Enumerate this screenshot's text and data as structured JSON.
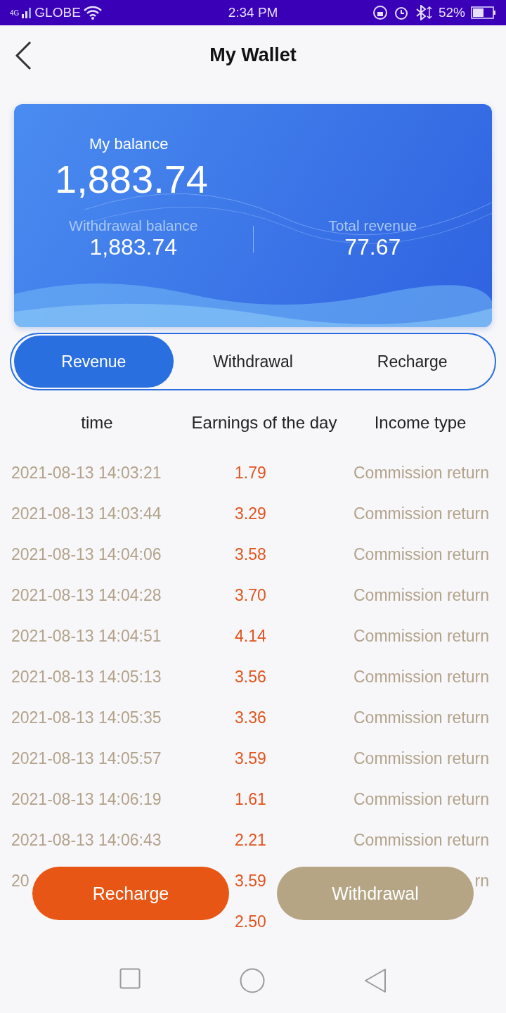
{
  "status_bar": {
    "network": "4G",
    "carrier": "GLOBE",
    "time": "2:34 PM",
    "battery": "52%"
  },
  "header": {
    "title": "My Wallet"
  },
  "balance_card": {
    "label": "My balance",
    "amount": "1,883.74",
    "stats": [
      {
        "label": "Withdrawal balance",
        "value": "1,883.74"
      },
      {
        "label": "Total revenue",
        "value": "77.67"
      }
    ]
  },
  "tabs": [
    {
      "label": "Revenue",
      "selected": true
    },
    {
      "label": "Withdrawal",
      "selected": false
    },
    {
      "label": "Recharge",
      "selected": false
    }
  ],
  "table": {
    "columns": [
      "time",
      "Earnings of the day",
      "Income type"
    ],
    "rows": [
      {
        "time": "2021-08-13 14:03:21",
        "amount": "1.79",
        "type": "Commission return"
      },
      {
        "time": "2021-08-13 14:03:44",
        "amount": "3.29",
        "type": "Commission return"
      },
      {
        "time": "2021-08-13 14:04:06",
        "amount": "3.58",
        "type": "Commission return"
      },
      {
        "time": "2021-08-13 14:04:28",
        "amount": "3.70",
        "type": "Commission return"
      },
      {
        "time": "2021-08-13 14:04:51",
        "amount": "4.14",
        "type": "Commission return"
      },
      {
        "time": "2021-08-13 14:05:13",
        "amount": "3.56",
        "type": "Commission return"
      },
      {
        "time": "2021-08-13 14:05:35",
        "amount": "3.36",
        "type": "Commission return"
      },
      {
        "time": "2021-08-13 14:05:57",
        "amount": "3.59",
        "type": "Commission return"
      },
      {
        "time": "2021-08-13 14:06:19",
        "amount": "1.61",
        "type": "Commission return"
      },
      {
        "time": "2021-08-13 14:06:43",
        "amount": "2.21",
        "type": "Commission return"
      },
      {
        "time": "20",
        "amount": "3.59",
        "type": "rn"
      },
      {
        "amount": "2.50"
      }
    ]
  },
  "actions": [
    {
      "label": "Recharge",
      "kind": "primary"
    },
    {
      "label": "Withdrawal",
      "kind": "secondary"
    }
  ]
}
